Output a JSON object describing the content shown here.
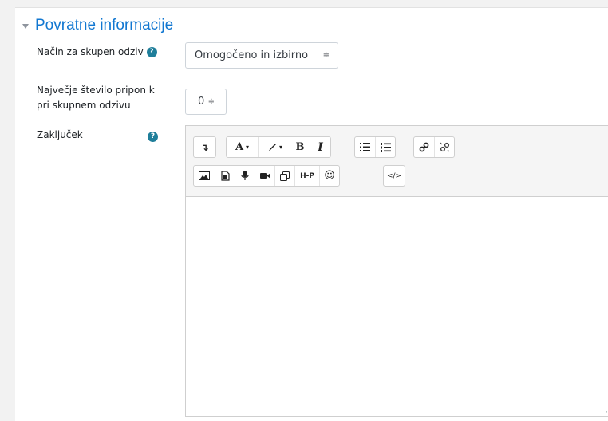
{
  "section": {
    "title": "Povratne informacije"
  },
  "fields": {
    "group_mode": {
      "label": "Način za skupen odziv",
      "value": "Omogočeno in izbirno"
    },
    "max_attachments": {
      "label_line1": "Največje število pripon k",
      "label_line2": "pri skupnem odzivu",
      "value": "0"
    },
    "conclusion": {
      "label": "Zaključek"
    }
  },
  "help_icon": "?",
  "select_arrow": "≑",
  "editor": {
    "toolbar_row1": {
      "collapse": "↴",
      "font_color": "A",
      "dropdown_caret": "▾",
      "bold": "B",
      "italic": "I",
      "unordered_list": "≔",
      "ordered_list": "⁝≡",
      "link": "🔗",
      "unlink": "⛓"
    },
    "toolbar_row2": {
      "h5p": "H-P",
      "emoji": "☺",
      "html": "</>"
    },
    "resize_grip": "⠠⠤"
  }
}
